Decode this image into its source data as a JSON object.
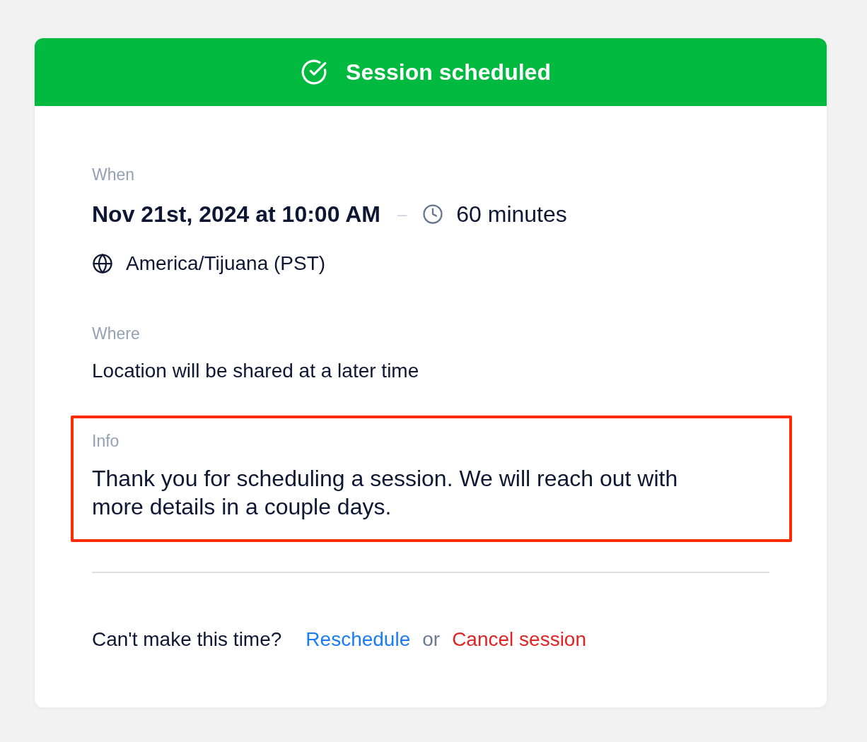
{
  "header": {
    "title": "Session scheduled"
  },
  "sections": [
    {
      "kind": "when",
      "label": "When",
      "datetime": "Nov 21st, 2024 at 10:00 AM",
      "separator": "–",
      "duration": "60 minutes",
      "timezone": "America/Tijuana (PST)",
      "highlighted": false
    },
    {
      "kind": "where",
      "label": "Where",
      "text": "Location will be shared at a later time",
      "highlighted": false
    },
    {
      "kind": "info",
      "label": "Info",
      "text": "Thank you for scheduling a session. We will reach out with more details in a couple days.",
      "highlighted": true
    }
  ],
  "footer": {
    "prompt": "Can't make this time?",
    "links": [
      {
        "kind": "reschedule",
        "label": "Reschedule"
      },
      {
        "kind": "cancel",
        "label": "Cancel session"
      }
    ],
    "separator": "or"
  }
}
